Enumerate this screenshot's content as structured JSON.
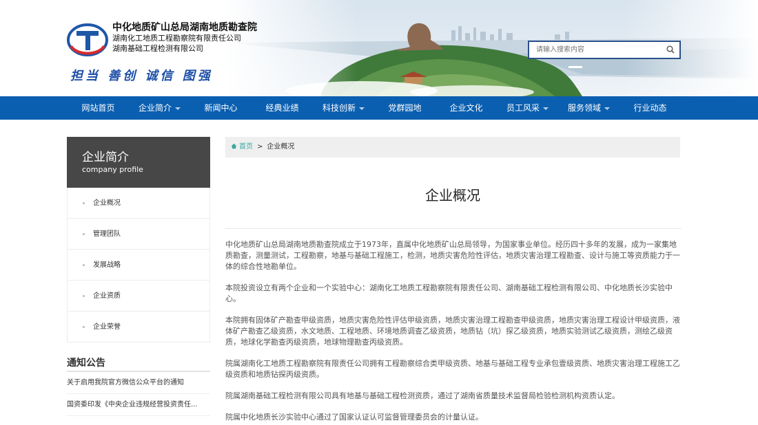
{
  "header": {
    "org_main": "中化地质矿山总局湖南地质勘查院",
    "org_sub_1": "湖南化工地质工程勘察院有限责任公司",
    "org_sub_2": "湖南基础工程检测有限公司",
    "slogan": "担当 善创  诚信 图强",
    "search_placeholder": "请输入搜索内容"
  },
  "nav": {
    "items": [
      {
        "label": "网站首页",
        "dropdown": false
      },
      {
        "label": "企业简介",
        "dropdown": true
      },
      {
        "label": "新闻中心",
        "dropdown": false
      },
      {
        "label": "经典业绩",
        "dropdown": false
      },
      {
        "label": "科技创新",
        "dropdown": true
      },
      {
        "label": "党群园地",
        "dropdown": false
      },
      {
        "label": "企业文化",
        "dropdown": false
      },
      {
        "label": "员工风采",
        "dropdown": true
      },
      {
        "label": "服务领域",
        "dropdown": true
      },
      {
        "label": "行业动态",
        "dropdown": false
      }
    ]
  },
  "sidebar": {
    "title": "企业简介",
    "title_en": "company profile",
    "items": [
      {
        "label": "企业概况"
      },
      {
        "label": "管理团队"
      },
      {
        "label": "发展战略"
      },
      {
        "label": "企业资质"
      },
      {
        "label": "企业荣誉"
      }
    ]
  },
  "notice": {
    "title": "通知公告",
    "items": [
      {
        "label": "关于启用我院官方微信公众平台的通知"
      },
      {
        "label": "国资委印发《中央企业违规经营投资责任..."
      }
    ]
  },
  "breadcrumb": {
    "home": "首页",
    "separator": ">",
    "current": "企业概况"
  },
  "main": {
    "title": "企业概况",
    "paragraphs": [
      "中化地质矿山总局湖南地质勘查院成立于1973年，直属中化地质矿山总局领导，为国家事业单位。经历四十多年的发展，成为一家集地质勘查，测量测试，工程勘察，地基与基础工程施工，检测，地质灾害危险性评估，地质灾害治理工程勘查、设计与施工等资质能力于一体的综合性地勘单位。",
      "本院投资设立有两个企业和一个实验中心：湖南化工地质工程勘察院有限责任公司、湖南基础工程检测有限公司、中化地质长沙实验中心。",
      "本院拥有固体矿产勘查甲级资质，地质灾害危险性评估甲级资质，地质灾害治理工程勘查甲级资质，地质灾害治理工程设计甲级资质，液体矿产勘查乙级资质，水文地质、工程地质、环境地质调查乙级资质，地质钻（坑）探乙级资质，地质实验测试乙级资质，测绘乙级资质，地球化学勘查丙级资质，地球物理勘查丙级资质。",
      "院属湖南化工地质工程勘察院有限责任公司拥有工程勘察综合类甲级资质、地基与基础工程专业承包壹级资质、地质灾害治理工程施工乙级资质和地质钻探丙级资质。",
      "院属湖南基础工程检测有限公司具有地基与基础工程检测资质，通过了湖南省质量技术监督局检验检测机构资质认定。",
      "院属中化地质长沙实验中心通过了国家认证认可监督管理委员会的计量认证。"
    ]
  },
  "colors": {
    "nav_bg": "#0b5fb0",
    "sidebar_head_bg": "#474747",
    "slogan": "#1d4fa6",
    "breadcrumb_home": "#3aa8a0",
    "search_border": "#2a4f8a"
  },
  "icons": {
    "logo": "company-logo",
    "search": "search-icon",
    "home": "home-icon"
  }
}
